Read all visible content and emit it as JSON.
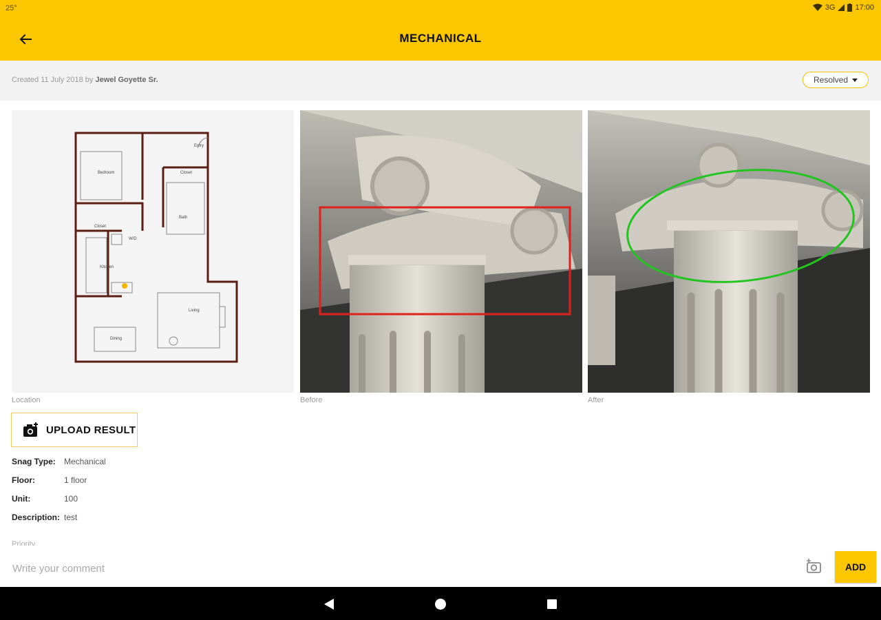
{
  "status_bar": {
    "left_text": "25°",
    "network": "3G",
    "time": "17:00"
  },
  "app_bar": {
    "title": "MECHANICAL",
    "back_icon": "arrow-left-icon"
  },
  "meta": {
    "created_prefix": "Created 11 July 2018 by ",
    "created_by": "Jewel Goyette Sr.",
    "status_value": "Resolved"
  },
  "images": {
    "location_caption": "Location",
    "before_caption": "Before",
    "after_caption": "After",
    "floorplan_labels": {
      "entry": "Entry",
      "bedroom": "Bedroom",
      "closet1": "Closet",
      "closet2": "Closet",
      "bath": "Bath",
      "wd": "W/D",
      "kitchen": "Kitchen",
      "living": "Living",
      "dining": "Dining"
    }
  },
  "upload": {
    "label": "UPLOAD RESULT"
  },
  "details": [
    {
      "key": "Snag Type:",
      "value": "Mechanical"
    },
    {
      "key": "Floor:",
      "value": "1 floor"
    },
    {
      "key": "Unit:",
      "value": "100"
    },
    {
      "key": "Description:",
      "value": "test"
    }
  ],
  "partial_label": "Priority",
  "comment": {
    "placeholder": "Write your comment",
    "add_label": "ADD"
  },
  "colors": {
    "accent": "#fcc700",
    "before_marker": "#e0201c",
    "after_marker": "#22c41f"
  }
}
